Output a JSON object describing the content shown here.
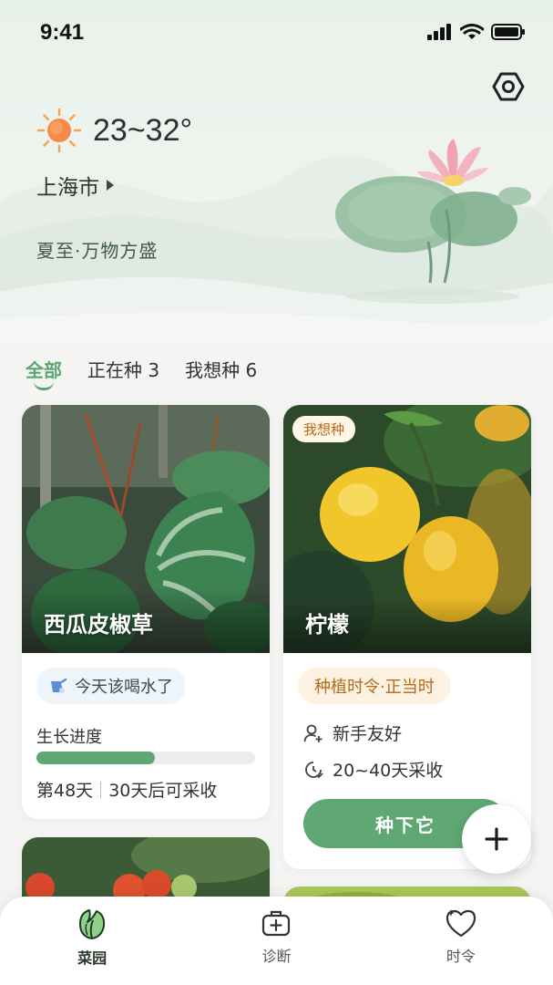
{
  "status_bar": {
    "time": "9:41"
  },
  "weather": {
    "temperature": "23~32°",
    "city": "上海市",
    "solar_term": "夏至·万物方盛"
  },
  "tabs": [
    {
      "label": "全部",
      "active": true
    },
    {
      "label": "正在种 3",
      "active": false
    },
    {
      "label": "我想种 6",
      "active": false
    }
  ],
  "cards": [
    {
      "name": "西瓜皮椒草",
      "reminder": "今天该喝水了",
      "growth_label": "生长进度",
      "growth_progress": 0.54,
      "day_text": "第48天",
      "harvest_text": "30天后可采收"
    },
    {
      "name": "柠檬",
      "tag": "我想种",
      "season": "种植时令·正当时",
      "difficulty": "新手友好",
      "harvest": "20~40天采收",
      "button": "种下它"
    }
  ],
  "fab": {
    "icon": "plus-icon"
  },
  "bottom_nav": [
    {
      "label": "菜园",
      "icon": "cabbage-icon",
      "active": true
    },
    {
      "label": "诊断",
      "icon": "medkit-icon",
      "active": false
    },
    {
      "label": "时令",
      "icon": "heart-sparkle-icon",
      "active": false
    }
  ],
  "colors": {
    "accent": "#5fa874",
    "tag_orange": "#b26a1d",
    "water_bg": "#eef5fb"
  }
}
